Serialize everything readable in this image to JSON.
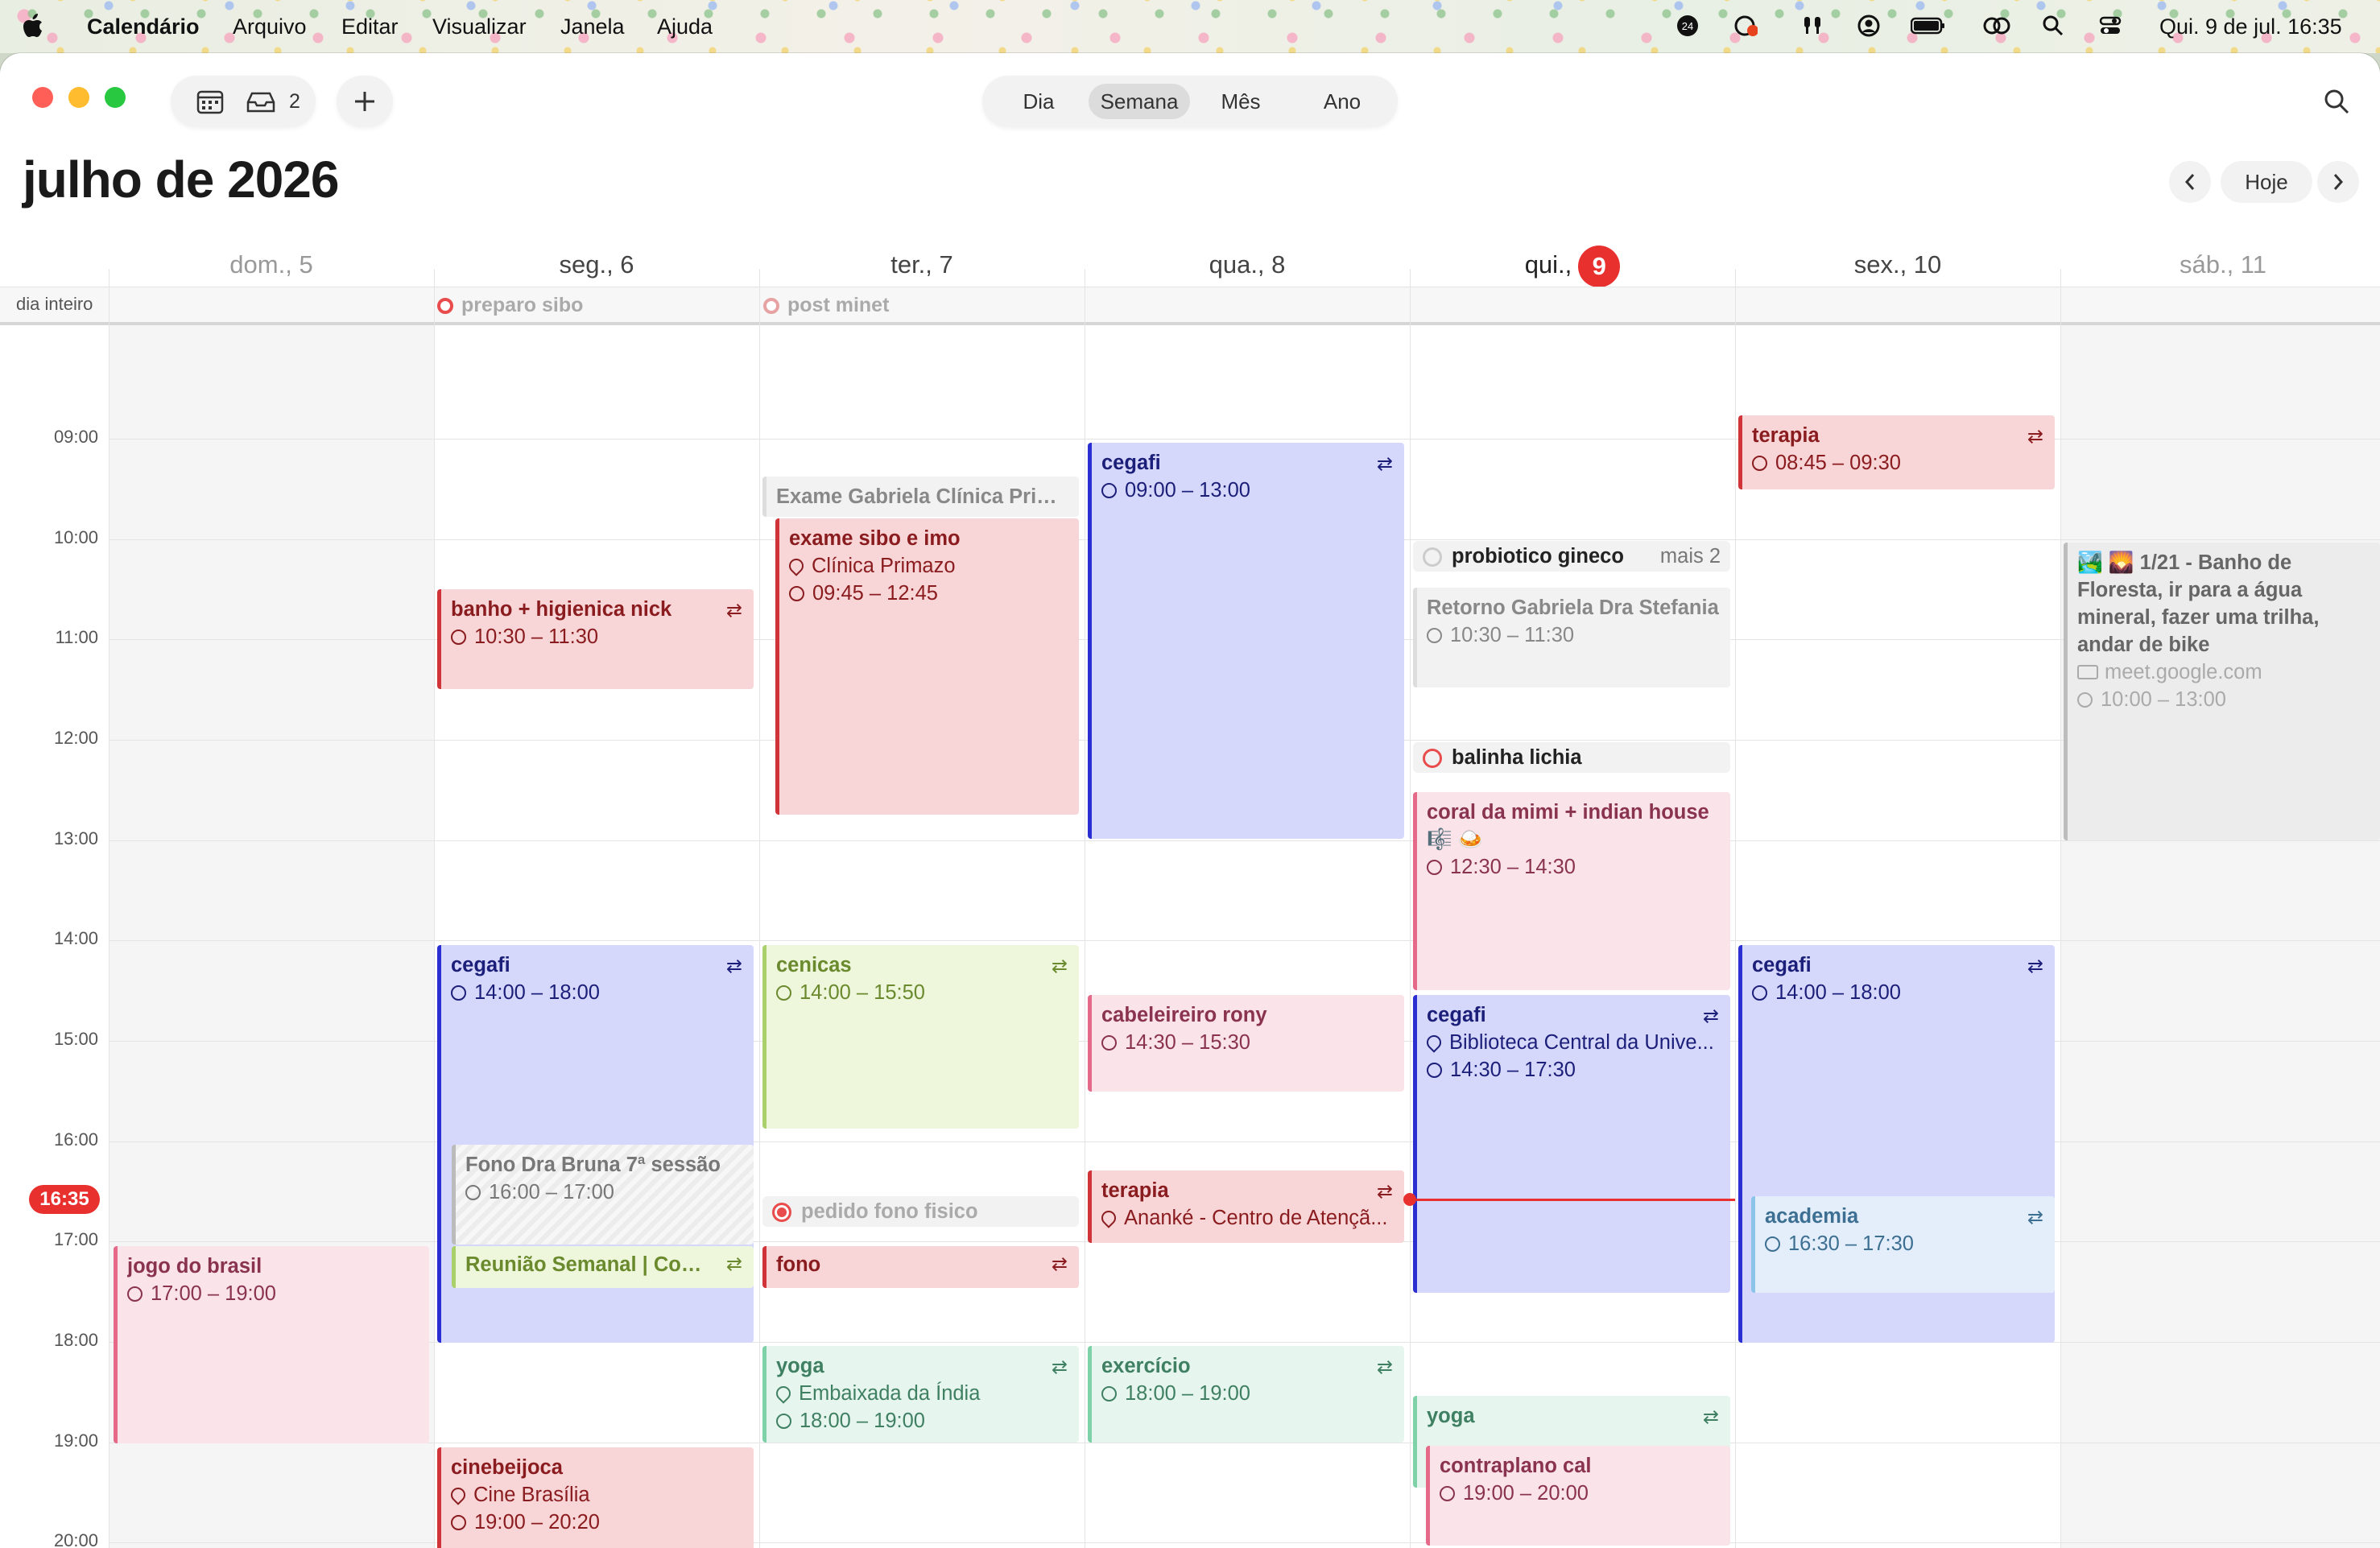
{
  "menubar": {
    "app_name": "Calendário",
    "menus": [
      "Arquivo",
      "Editar",
      "Visualizar",
      "Janela",
      "Ajuda"
    ],
    "clock": "Qui. 9 de jul.  16:35"
  },
  "toolbar": {
    "inbox_count": "2",
    "views": [
      "Dia",
      "Semana",
      "Mês",
      "Ano"
    ],
    "active_view": "Semana",
    "today_button": "Hoje"
  },
  "header": {
    "title": "julho de 2026"
  },
  "days": [
    "dom., 5",
    "seg., 6",
    "ter., 7",
    "qua., 8",
    "qui.,",
    "sex., 10",
    "sáb., 11"
  ],
  "today_number": "9",
  "allday": {
    "label": "dia inteiro",
    "events": [
      {
        "title": "preparo sibo",
        "day": 1
      },
      {
        "title": "post minet",
        "day": 2
      }
    ]
  },
  "hours": [
    "09:00",
    "10:00",
    "11:00",
    "12:00",
    "13:00",
    "14:00",
    "15:00",
    "16:00",
    "17:00",
    "18:00",
    "19:00",
    "20:00"
  ],
  "now": "16:35",
  "events": {
    "banho": {
      "title": "banho + higienica nick",
      "time": "10:30 – 11:30"
    },
    "cegafi_mon": {
      "title": "cegafi",
      "time": "14:00 – 18:00"
    },
    "fono_bruna": {
      "title": "Fono Dra Bruna 7ª sessão",
      "time": "16:00 – 17:00"
    },
    "reuniao": {
      "title": "Reunião Semanal | Com..."
    },
    "cinebeijoca": {
      "title": "cinebeijoca",
      "location": "Cine Brasília",
      "time": "19:00 – 20:20"
    },
    "jogo": {
      "title": "jogo do brasil",
      "time": "17:00 – 19:00"
    },
    "exame_gabriela": {
      "title": "Exame Gabriela Clínica Prim..."
    },
    "exame_sibo": {
      "title": "exame sibo e imo",
      "location": "Clínica Primazo",
      "time": "09:45 – 12:45"
    },
    "cenicas": {
      "title": "cenicas",
      "time": "14:00 – 15:50"
    },
    "pedido_fono": {
      "title": "pedido fono fisico"
    },
    "fono": {
      "title": "fono"
    },
    "yoga_tue": {
      "title": "yoga",
      "location": "Embaixada da Índia",
      "time": "18:00 – 19:00"
    },
    "cegafi_wed": {
      "title": "cegafi",
      "time": "09:00 – 13:00"
    },
    "cabeleireiro": {
      "title": "cabeleireiro rony",
      "time": "14:30 – 15:30"
    },
    "terapia_wed": {
      "title": "terapia",
      "location": "Ananké - Centro de Atençã..."
    },
    "exercicio": {
      "title": "exercício",
      "time": "18:00 – 19:00"
    },
    "probiotico": {
      "title": "probiotico gineco",
      "more": "mais 2"
    },
    "retorno": {
      "title": "Retorno Gabriela Dra Stefania",
      "time": "10:30 – 11:30"
    },
    "balinha": {
      "title": "balinha lichia"
    },
    "coral": {
      "title": "coral da mimi + indian house 🎼 🍛",
      "time": "12:30 – 14:30"
    },
    "cegafi_thu": {
      "title": "cegafi",
      "location": "Biblioteca Central da Unive...",
      "time": "14:30 – 17:30"
    },
    "yoga_thu": {
      "title": "yoga"
    },
    "contraplano": {
      "title": "contraplano cal",
      "time": "19:00 – 20:00"
    },
    "terapia_fri": {
      "title": "terapia",
      "time": "08:45 – 09:30"
    },
    "cegafi_fri": {
      "title": "cegafi",
      "time": "14:00 – 18:00"
    },
    "academia": {
      "title": "academia",
      "time": "16:30 – 17:30"
    },
    "banho_floresta": {
      "title": "🏞️ 🌄 1/21 - Banho de Floresta, ir para a água mineral, fazer uma trilha, andar de bike",
      "link": "meet.google.com",
      "time": "10:00 – 13:00"
    }
  }
}
